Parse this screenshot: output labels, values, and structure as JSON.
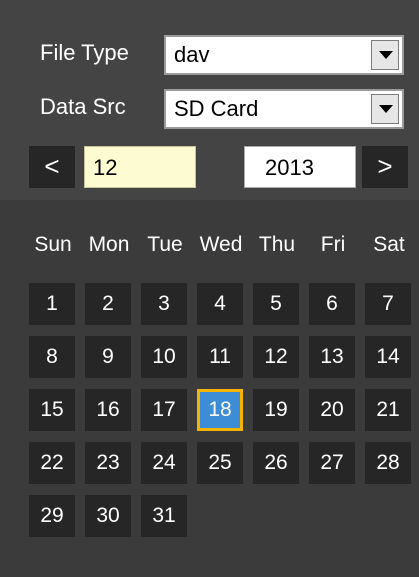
{
  "filters": {
    "file_type_label": "File Type",
    "file_type_value": "dav",
    "data_src_label": "Data Src",
    "data_src_value": "SD Card"
  },
  "month_nav": {
    "prev_symbol": "<",
    "next_symbol": ">",
    "month": "12",
    "year": "2013"
  },
  "weekdays": [
    "Sun",
    "Mon",
    "Tue",
    "Wed",
    "Thu",
    "Fri",
    "Sat"
  ],
  "days": [
    "1",
    "2",
    "3",
    "4",
    "5",
    "6",
    "7",
    "8",
    "9",
    "10",
    "11",
    "12",
    "13",
    "14",
    "15",
    "16",
    "17",
    "18",
    "19",
    "20",
    "21",
    "22",
    "23",
    "24",
    "25",
    "26",
    "27",
    "28",
    "29",
    "30",
    "31"
  ],
  "selected_day": "18",
  "colors": {
    "panel_bg": "#444444",
    "cell_bg": "#262626",
    "selected_bg": "#3d8dd6",
    "selected_border": "#f5b400",
    "month_input_bg": "#fdfbd1"
  },
  "icons": {
    "dropdown": "chevron-down-icon",
    "prev": "chevron-left-icon",
    "next": "chevron-right-icon"
  }
}
